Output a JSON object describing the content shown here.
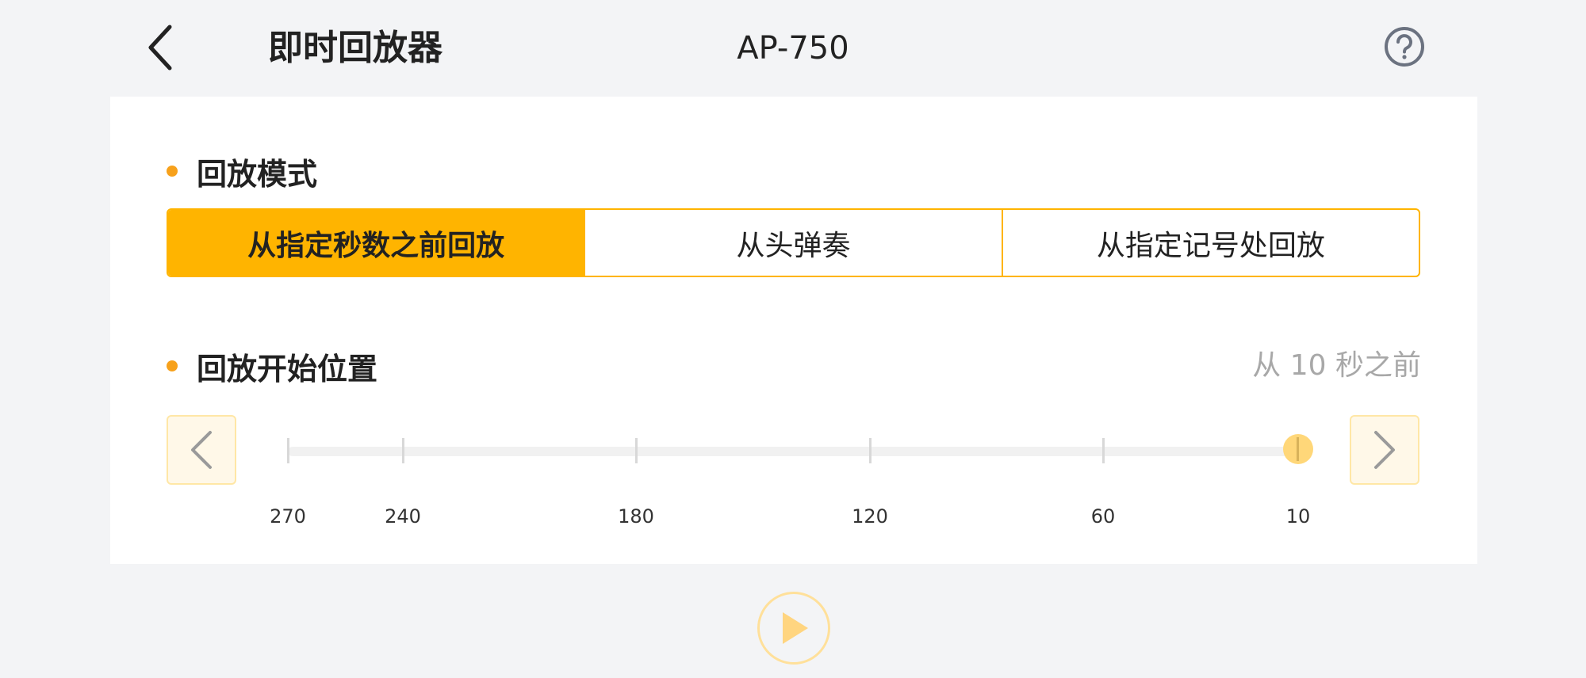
{
  "header": {
    "back_icon": "chevron-left-icon",
    "title": "即时回放器",
    "device": "AP-750",
    "help_icon": "question-circle-icon"
  },
  "playback_mode": {
    "label": "回放模式",
    "options": [
      {
        "label": "从指定秒数之前回放",
        "selected": true
      },
      {
        "label": "从头弹奏",
        "selected": false
      },
      {
        "label": "从指定记号处回放",
        "selected": false
      }
    ]
  },
  "start_position": {
    "label": "回放开始位置",
    "value_text": "从 10 秒之前",
    "value_seconds": 10,
    "ticks": [
      "270",
      "240",
      "180",
      "120",
      "60",
      "10"
    ],
    "prev_icon": "chevron-left-icon",
    "next_icon": "chevron-right-icon"
  },
  "play": {
    "icon": "play-icon"
  },
  "colors": {
    "accent": "#ffb400",
    "bullet": "#f7a11b",
    "muted_text": "#a8a8a8"
  }
}
